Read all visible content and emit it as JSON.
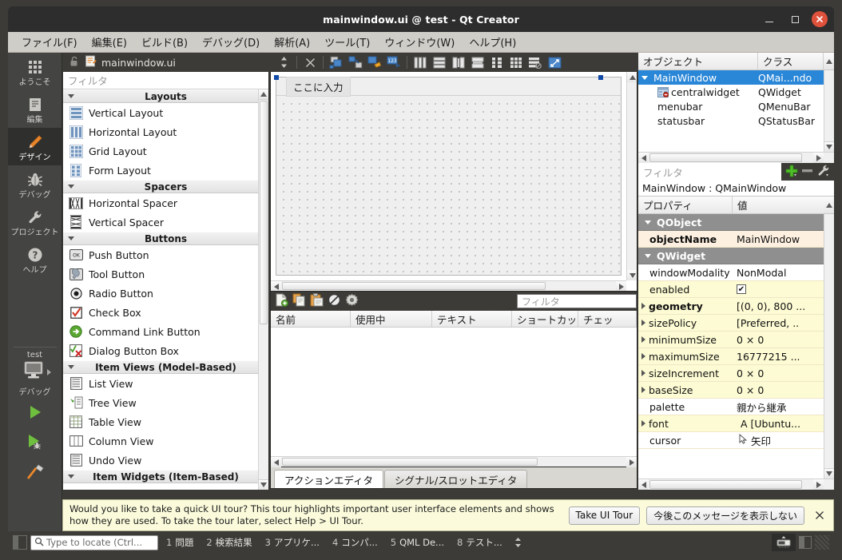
{
  "window": {
    "title": "mainwindow.ui @ test - Qt Creator",
    "minimize": "minimize-button",
    "maximize": "maximize-button",
    "close": "close-button"
  },
  "menubar": [
    {
      "label": "ファイル(F)",
      "mnemonic": "F"
    },
    {
      "label": "編集(E)",
      "mnemonic": "E"
    },
    {
      "label": "ビルド(B)",
      "mnemonic": "B"
    },
    {
      "label": "デバッグ(D)",
      "mnemonic": "D"
    },
    {
      "label": "解析(A)",
      "mnemonic": "A"
    },
    {
      "label": "ツール(T)",
      "mnemonic": "T"
    },
    {
      "label": "ウィンドウ(W)",
      "mnemonic": "W"
    },
    {
      "label": "ヘルプ(H)",
      "mnemonic": "H"
    }
  ],
  "modes": [
    {
      "label": "ようこそ",
      "icon": "grid-icon",
      "active": false
    },
    {
      "label": "編集",
      "icon": "document-icon",
      "active": false
    },
    {
      "label": "デザイン",
      "icon": "pencil-icon",
      "active": true
    },
    {
      "label": "デバッグ",
      "icon": "bug-icon",
      "active": false
    },
    {
      "label": "プロジェクト",
      "icon": "wrench-icon",
      "active": false
    },
    {
      "label": "ヘルプ",
      "icon": "question-icon",
      "active": false
    }
  ],
  "kit": {
    "project": "test",
    "build_config": "デバッグ",
    "run_label": "run-button",
    "debug_label": "debug-button",
    "build_label": "build-button"
  },
  "editor_tab": {
    "filename": "mainwindow.ui",
    "lock_icon": "unlock-icon",
    "file_icon": "ui-file-icon"
  },
  "widget_box": {
    "filter_placeholder": "フィルタ",
    "groups": [
      {
        "title": "Layouts",
        "items": [
          {
            "label": "Vertical Layout",
            "icon": "vertical-layout-icon"
          },
          {
            "label": "Horizontal Layout",
            "icon": "horizontal-layout-icon"
          },
          {
            "label": "Grid Layout",
            "icon": "grid-layout-icon"
          },
          {
            "label": "Form Layout",
            "icon": "form-layout-icon"
          }
        ]
      },
      {
        "title": "Spacers",
        "items": [
          {
            "label": "Horizontal Spacer",
            "icon": "horizontal-spacer-icon"
          },
          {
            "label": "Vertical Spacer",
            "icon": "vertical-spacer-icon"
          }
        ]
      },
      {
        "title": "Buttons",
        "items": [
          {
            "label": "Push Button",
            "icon": "push-button-icon"
          },
          {
            "label": "Tool Button",
            "icon": "tool-button-icon"
          },
          {
            "label": "Radio Button",
            "icon": "radio-button-icon"
          },
          {
            "label": "Check Box",
            "icon": "check-box-icon"
          },
          {
            "label": "Command Link Button",
            "icon": "command-link-icon"
          },
          {
            "label": "Dialog Button Box",
            "icon": "dialog-button-box-icon"
          }
        ]
      },
      {
        "title": "Item Views (Model-Based)",
        "items": [
          {
            "label": "List View",
            "icon": "list-view-icon"
          },
          {
            "label": "Tree View",
            "icon": "tree-view-icon"
          },
          {
            "label": "Table View",
            "icon": "table-view-icon"
          },
          {
            "label": "Column View",
            "icon": "column-view-icon"
          },
          {
            "label": "Undo View",
            "icon": "undo-view-icon"
          }
        ]
      },
      {
        "title": "Item Widgets (Item-Based)",
        "items": []
      }
    ]
  },
  "design_toolbar": [
    {
      "name": "split-selector",
      "icon": "updown-arrows-icon"
    },
    {
      "name": "close-editor",
      "icon": "close-x-icon"
    },
    {
      "name": "edit-widgets",
      "icon": "edit-widgets-icon"
    },
    {
      "name": "edit-signals-slots",
      "icon": "signals-slots-icon"
    },
    {
      "name": "edit-buddies",
      "icon": "buddies-icon"
    },
    {
      "name": "edit-tab-order",
      "icon": "tab-order-icon"
    },
    {
      "name": "layout-horizontally",
      "icon": "layout-horizontal-icon"
    },
    {
      "name": "layout-vertically",
      "icon": "layout-vertical-icon"
    },
    {
      "name": "layout-splitter-horizontal",
      "icon": "splitter-h-icon"
    },
    {
      "name": "layout-splitter-vertical",
      "icon": "splitter-v-icon"
    },
    {
      "name": "layout-form",
      "icon": "layout-form-icon"
    },
    {
      "name": "layout-grid",
      "icon": "layout-grid-icon"
    },
    {
      "name": "break-layout",
      "icon": "break-layout-icon"
    },
    {
      "name": "adjust-size",
      "icon": "adjust-size-icon"
    }
  ],
  "form": {
    "menubar_placeholder": "ここに入力"
  },
  "action_editor": {
    "toolbar": [
      {
        "name": "new-action-button",
        "icon": "new-file-icon"
      },
      {
        "name": "copy-action-button",
        "icon": "copy-icon"
      },
      {
        "name": "paste-action-button",
        "icon": "paste-icon"
      },
      {
        "name": "delete-action-button",
        "icon": "delete-icon"
      },
      {
        "name": "action-settings-button",
        "icon": "gear-icon"
      }
    ],
    "filter_placeholder": "フィルタ",
    "columns": [
      "名前",
      "使用中",
      "テキスト",
      "ショートカッ",
      "チェッ"
    ],
    "rows": []
  },
  "bottom_tabs": [
    {
      "label": "アクションエディタ",
      "active": true
    },
    {
      "label": "シグナル/スロットエディタ",
      "active": false
    }
  ],
  "object_tree": {
    "columns": [
      "オブジェクト",
      "クラス"
    ],
    "rows": [
      {
        "object": "MainWindow",
        "class": "QMai...ndo",
        "indent": 0,
        "selected": true,
        "expander": true,
        "icon": ""
      },
      {
        "object": "centralwidget",
        "class": "QWidget",
        "indent": 1,
        "selected": false,
        "expander": false,
        "icon": "central-widget-icon"
      },
      {
        "object": "menubar",
        "class": "QMenuBar",
        "indent": 1,
        "selected": false,
        "expander": false,
        "icon": ""
      },
      {
        "object": "statusbar",
        "class": "QStatusBar",
        "indent": 1,
        "selected": false,
        "expander": false,
        "icon": ""
      }
    ]
  },
  "property_editor": {
    "filter_placeholder": "フィルタ",
    "tools": [
      {
        "name": "add-dynamic-property-button",
        "icon": "plus-icon"
      },
      {
        "name": "remove-dynamic-property-button",
        "icon": "minus-icon"
      },
      {
        "name": "configure-button",
        "icon": "wrench-icon"
      }
    ],
    "object_label": "MainWindow : QMainWindow",
    "columns": [
      "プロパティ",
      "値"
    ],
    "rows": [
      {
        "kind": "group",
        "name": "QObject"
      },
      {
        "kind": "prop",
        "name": "objectName",
        "value": "MainWindow",
        "bold": true,
        "expandable": false,
        "style": "y2"
      },
      {
        "kind": "group",
        "name": "QWidget"
      },
      {
        "kind": "prop",
        "name": "windowModality",
        "value": "NonModal",
        "bold": false,
        "expandable": false,
        "style": "w"
      },
      {
        "kind": "prop",
        "name": "enabled",
        "value": "",
        "checkbox": true,
        "bold": false,
        "expandable": false,
        "style": "y"
      },
      {
        "kind": "prop",
        "name": "geometry",
        "value": "[(0, 0), 800 ...",
        "bold": true,
        "expandable": true,
        "style": "y"
      },
      {
        "kind": "prop",
        "name": "sizePolicy",
        "value": "[Preferred, ..",
        "bold": false,
        "expandable": true,
        "style": "y"
      },
      {
        "kind": "prop",
        "name": "minimumSize",
        "value": "0 × 0",
        "bold": false,
        "expandable": true,
        "style": "y"
      },
      {
        "kind": "prop",
        "name": "maximumSize",
        "value": "16777215 ...",
        "bold": false,
        "expandable": true,
        "style": "y"
      },
      {
        "kind": "prop",
        "name": "sizeIncrement",
        "value": "0 × 0",
        "bold": false,
        "expandable": true,
        "style": "y"
      },
      {
        "kind": "prop",
        "name": "baseSize",
        "value": "0 × 0",
        "bold": false,
        "expandable": true,
        "style": "y"
      },
      {
        "kind": "prop",
        "name": "palette",
        "value": "親から継承",
        "bold": false,
        "expandable": false,
        "style": "w"
      },
      {
        "kind": "prop",
        "name": "font",
        "value": "A  [Ubuntu...",
        "bold": false,
        "expandable": true,
        "style": "y"
      },
      {
        "kind": "prop",
        "name": "cursor",
        "value": "矢印",
        "cursorIcon": true,
        "bold": false,
        "expandable": false,
        "style": "w"
      }
    ]
  },
  "notification": {
    "message": "Would you like to take a quick UI tour? This tour highlights important user interface elements and shows how they are used. To take the tour later, select Help > UI Tour.",
    "primary_button": "Take UI Tour",
    "secondary_button": "今後このメッセージを表示しない",
    "close_icon": "close-x-icon"
  },
  "statusbar": {
    "locator_placeholder": "Type to locate (Ctrl...",
    "locator_icon": "search-icon",
    "items": [
      {
        "num": "1",
        "label": "問題"
      },
      {
        "num": "2",
        "label": "検索結果"
      },
      {
        "num": "3",
        "label": "アプリケ..."
      },
      {
        "num": "4",
        "label": "コンパ..."
      },
      {
        "num": "5",
        "label": "QML De..."
      },
      {
        "num": "8",
        "label": "テスト..."
      }
    ],
    "right_icons": [
      {
        "name": "output-pane-toggle",
        "icon": "output-icon"
      },
      {
        "name": "sidebar-toggle",
        "icon": "sidebar-icon"
      }
    ]
  },
  "colors": {
    "titlebar_bg": "#2d2d2d",
    "menubar_bg": "#cfcdc8",
    "chrome_bg": "#3c3b37",
    "mode_bg": "#444442",
    "mode_active_bg": "#2f2f2e",
    "selection_blue": "#2a87d8",
    "close_red": "#e0513b",
    "property_yellow": "#fdfbd3",
    "notification_bg": "#fbfbdc",
    "handle_blue": "#1049a8"
  }
}
